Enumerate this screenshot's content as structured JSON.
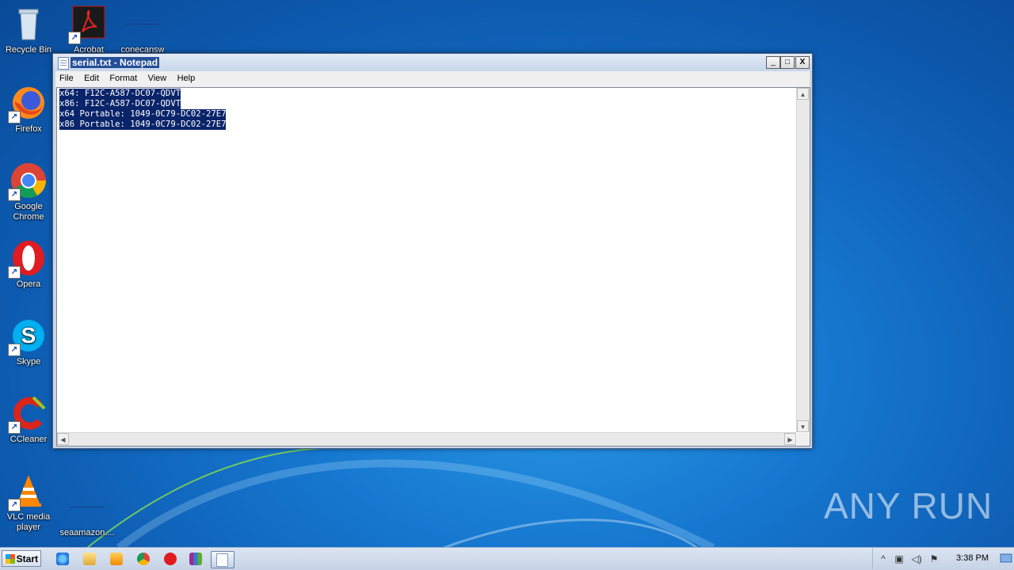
{
  "desktop": {
    "icons": [
      {
        "label": "Recycle Bin",
        "icon": "recycle-bin-icon"
      },
      {
        "label": "Acrobat",
        "icon": "acrobat-icon"
      },
      {
        "label": "conecansw",
        "icon": "blank-file-icon"
      },
      {
        "label": "Firefox",
        "icon": "firefox-icon"
      },
      {
        "label": "Google Chrome",
        "icon": "chrome-icon"
      },
      {
        "label": "Opera",
        "icon": "opera-icon"
      },
      {
        "label": "Skype",
        "icon": "skype-icon"
      },
      {
        "label": "CCleaner",
        "icon": "ccleaner-icon"
      },
      {
        "label": "VLC media player",
        "icon": "vlc-icon"
      },
      {
        "label": "seaamazon....",
        "icon": "blank-file-icon"
      }
    ]
  },
  "notepad": {
    "title": "serial.txt - Notepad",
    "menu": [
      "File",
      "Edit",
      "Format",
      "View",
      "Help"
    ],
    "lines": [
      "x64: F12C-A587-DC07-QDVT",
      "x86: F12C-A587-DC07-QDVT",
      "x64 Portable: 1049-0C79-DC02-27E7",
      "x86 Portable: 1049-0C79-DC02-27E7"
    ],
    "buttons": {
      "minimize": "_",
      "maximize": "□",
      "close": "X"
    }
  },
  "watermark": "ANY RUN",
  "taskbar": {
    "start_label": "Start",
    "clock": "3:38 PM"
  },
  "colors": {
    "selection": "#0a246a",
    "desktop": "#1677cf"
  }
}
